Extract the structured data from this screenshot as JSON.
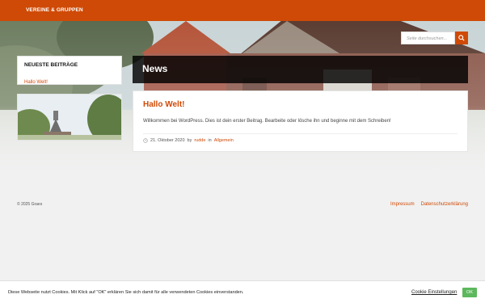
{
  "nav": {
    "menu_label": "VEREINE & GRUPPEN"
  },
  "search": {
    "placeholder": "Seite durchsuchen...",
    "icon": "search-icon"
  },
  "sidebar": {
    "widget_title": "NEUESTE BEITRÄGE",
    "recent_posts": [
      "Hallo Welt!"
    ]
  },
  "page": {
    "title": "News"
  },
  "post": {
    "title": "Hallo Welt!",
    "excerpt": "Willkommen bei WordPress. Dies ist dein erster Beitrag. Bearbeite oder lösche ihn und beginne mit dem Schreiben!",
    "date": "21. Oktober 2020",
    "by": "by",
    "author": "rudde",
    "in": "in",
    "category": "Allgemein"
  },
  "footer": {
    "copyright": "© 2025 Graes",
    "links": [
      "Impressum",
      "Datenschutzerklärung"
    ]
  },
  "cookie": {
    "text": "Diese Webseite nutzt Cookies. Mit Klick auf \"OK\" erklären Sie sich damit für alle verwendeten Cookies einverstanden.",
    "settings_label": "Cookie Einstellungen",
    "ok_label": "OK"
  },
  "colors": {
    "accent": "#cf4a06",
    "ok_green": "#5cb85c"
  }
}
